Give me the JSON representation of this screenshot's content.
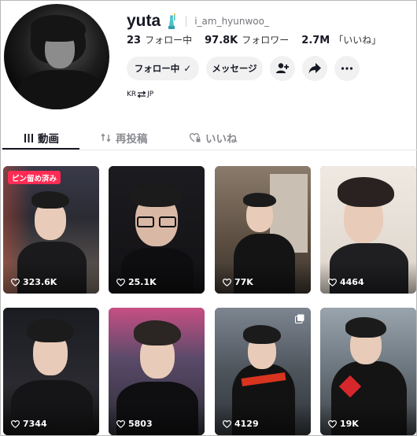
{
  "profile": {
    "display_name": "yuta",
    "handle": "i_am_hyunwoo_",
    "region": {
      "from": "KR",
      "to": "JP"
    }
  },
  "stats": [
    {
      "value": "23",
      "label": "フォロー中"
    },
    {
      "value": "97.8K",
      "label": "フォロワー"
    },
    {
      "value": "2.7M",
      "label": "「いいね」"
    }
  ],
  "actions": {
    "follow_label": "フォロー中",
    "follow_check": "✓",
    "message_label": "メッセージ"
  },
  "tabs": [
    {
      "label": "動画",
      "active": true
    },
    {
      "label": "再投稿",
      "active": false
    },
    {
      "label": "いいね",
      "active": false
    }
  ],
  "videos": [
    {
      "views": "323.6K",
      "pinned_label": "ピン留め済み"
    },
    {
      "views": "25.1K"
    },
    {
      "views": "77K"
    },
    {
      "views": "4464"
    },
    {
      "views": "7344"
    },
    {
      "views": "5803"
    },
    {
      "views": "4129"
    },
    {
      "views": "19K"
    }
  ],
  "colors": {
    "accent": "#fe2c55",
    "text": "#161823",
    "button_bg": "#f1f1f2"
  },
  "icons": [
    "statue-of-liberty-icon",
    "check-icon",
    "add-friend-icon",
    "share-icon",
    "more-icon",
    "grid-icon",
    "repost-icon",
    "heart-lock-icon",
    "heart-icon",
    "multi-photo-icon"
  ]
}
